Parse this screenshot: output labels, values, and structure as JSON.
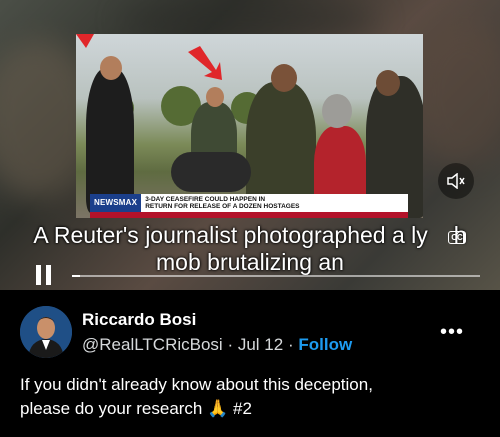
{
  "video": {
    "newsbar": {
      "brand": "NEWSMAX",
      "headline_line1": "3-DAY CEASEFIRE COULD HAPPEN IN",
      "headline_line2": "RETURN FOR RELEASE OF A DOZEN HOSTAGES"
    },
    "subtitle_line1": "A Reuter's journalist photographed a ly",
    "subtitle_line1_tail": "h",
    "subtitle_line2": "mob brutalizing an",
    "cc_label": "CC",
    "volume_icon": "speaker-icon",
    "progress": 0.02
  },
  "post": {
    "author_name": "Riccardo Bosi",
    "handle": "@RealLTCRicBosi",
    "separator": "·",
    "date": "Jul 12",
    "follow_label": "Follow",
    "more_label": "•••",
    "text_line1": "If you didn't already know about this deception,",
    "text_line2_prefix": "please do your research",
    "emoji": "🙏",
    "text_line2_suffix": "#2"
  },
  "colors": {
    "accent": "#1d9bf0",
    "background": "#000000",
    "newsmax_blue": "#1b3f8b",
    "ticker_red": "#b3122a"
  }
}
